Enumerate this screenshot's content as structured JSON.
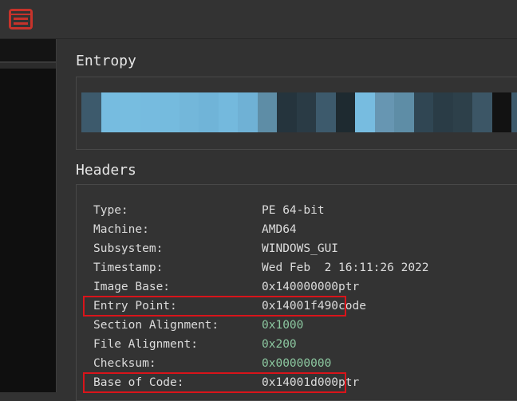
{
  "app": {
    "icon": "app-window-icon",
    "accent": "#d9342b"
  },
  "entropy": {
    "title": "Entropy",
    "segments": [
      "#3d5a6c",
      "#76bce0",
      "#77bde0",
      "#76bbdf",
      "#75bbde",
      "#73b7da",
      "#70b4d8",
      "#74b9dd",
      "#6fb1d5",
      "#5e8da6",
      "#25343d",
      "#2a3b45",
      "#3d5a6c",
      "#1e2a30",
      "#77bce0",
      "#6796b2",
      "#5e8da6",
      "#304653",
      "#2a3c46",
      "#2d404a",
      "#3c5666",
      "#121212",
      "#3d5a6c"
    ]
  },
  "headers": {
    "title": "Headers",
    "rows": [
      {
        "label": "Type:",
        "value": "PE 64-bit",
        "suffix": ""
      },
      {
        "label": "Machine:",
        "value": "AMD64",
        "suffix": ""
      },
      {
        "label": "Subsystem:",
        "value": "WINDOWS_GUI",
        "suffix": ""
      },
      {
        "label": "Timestamp:",
        "value": "Wed Feb  2 16:11:26 2022",
        "suffix": ""
      },
      {
        "label": "Image Base:",
        "value": "0x140000000",
        "suffix": "ptr"
      },
      {
        "label": "Entry Point:",
        "value": "0x14001f490",
        "suffix": "code"
      },
      {
        "label": "Section Alignment:",
        "value": "0x1000",
        "suffix": ""
      },
      {
        "label": "File Alignment:",
        "value": "0x200",
        "suffix": ""
      },
      {
        "label": "Checksum:",
        "value": "0x00000000",
        "suffix": ""
      },
      {
        "label": "Base of Code:",
        "value": "0x14001d000",
        "suffix": "ptr"
      }
    ],
    "highlighted": [
      "Entry Point:",
      "Base of Code:"
    ],
    "highlight_color": "#d9141a"
  }
}
